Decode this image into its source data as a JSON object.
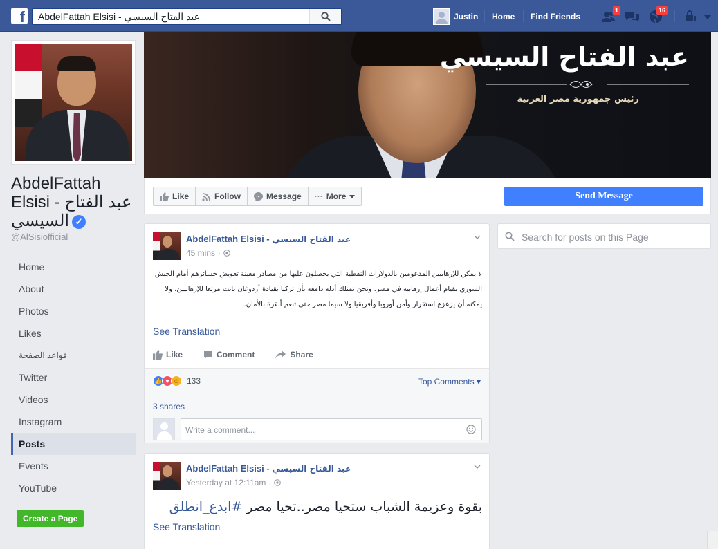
{
  "topbar": {
    "logo": "f",
    "search_value": "AbdelFattah Elsisi - عبد الفتاح السيسي",
    "user_name": "Justin",
    "home_label": "Home",
    "find_friends_label": "Find Friends",
    "friend_requests_badge": "1",
    "notifications_badge": "16",
    "brand_color": "#3b5998"
  },
  "sidebar": {
    "page_name": "AbdelFattah Elsisi - عبد الفتاح السيسي",
    "handle": "@AlSisiofficial",
    "nav": [
      {
        "label": "Home"
      },
      {
        "label": "About"
      },
      {
        "label": "Photos"
      },
      {
        "label": "Likes"
      },
      {
        "label": "قواعد الصفحة"
      },
      {
        "label": "Twitter"
      },
      {
        "label": "Videos"
      },
      {
        "label": "Instagram"
      },
      {
        "label": "Posts"
      },
      {
        "label": "Events"
      },
      {
        "label": "YouTube"
      }
    ],
    "create_page_label": "Create a Page"
  },
  "cover": {
    "title": "عبد الفتاح السيسي",
    "subtitle": "رئيس جمهورية مصر العربية"
  },
  "action_bar": {
    "like_label": "Like",
    "follow_label": "Follow",
    "message_label": "Message",
    "more_label": "More",
    "send_message_label": "Send Message",
    "accent_color": "#4080ff"
  },
  "page_search": {
    "placeholder": "Search for posts on this Page"
  },
  "posts": [
    {
      "author_en": "AbdelFattah Elsisi - ",
      "author_ar": "عبد الفتاح السيسي",
      "time": "45 mins",
      "text": "لا يمكن للإرهابيين المدعومين بالدولارات النفطية التي يحصلون عليها من مصادر معينة تعويض خسائرهم أمام الجيش السوري بقيام أعمال إرهابية في مصر. ونحن نمتلك أدلة دامغة بأن تركيا بقيادة أردوغان باتت مرتعا للإرهابيين، ولا يمكنه أن يزعزع استقرار وأمن أوروبا وأفريقيا ولا سيما مصر حتى تنعم أنقرة بالأمان.",
      "see_translation": "See Translation",
      "like_label": "Like",
      "comment_label": "Comment",
      "share_label": "Share",
      "reaction_count": "133",
      "top_comments_label": "Top Comments",
      "shares_label": "3 shares",
      "comment_placeholder": "Write a comment..."
    },
    {
      "author_en": "AbdelFattah Elsisi - ",
      "author_ar": "عبد الفتاح السيسي",
      "time": "Yesterday at 12:11am",
      "text_main": "بقوة وعزيمة الشباب ستحيا مصر..تحيا مصر ",
      "hashtag": "#ابدع_انطلق",
      "see_translation": "See Translation"
    }
  ]
}
